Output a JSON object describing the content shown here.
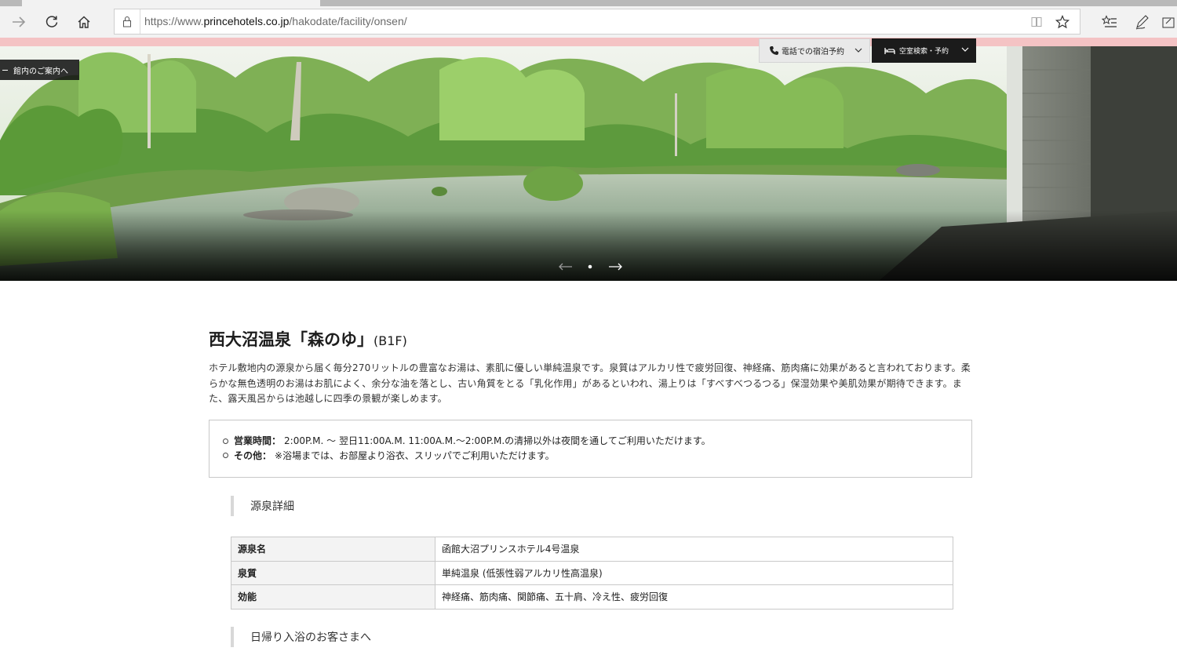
{
  "browser": {
    "url_prefix": "https://www.",
    "url_host": "princehotels.co.jp",
    "url_path": "/hakodate/facility/onsen/",
    "icons": [
      "forward-icon",
      "refresh-icon",
      "home-icon",
      "lock-icon",
      "reading-view-icon",
      "favorite-star-icon",
      "favorites-hub-icon",
      "web-note-icon",
      "share-icon"
    ]
  },
  "header": {
    "phone_booking": "電話での宿泊予約",
    "search_booking": "空室検索・予約",
    "guide_label": "館内のご案内へ"
  },
  "main": {
    "title": "西大沼温泉「森のゆ」",
    "title_sub": "(B1F)",
    "description": "ホテル敷地内の源泉から届く毎分270リットルの豊富なお湯は、素肌に優しい単純温泉です。泉質はアルカリ性で疲労回復、神経痛、筋肉痛に効果があると言われております。柔らかな無色透明のお湯はお肌によく、余分な油を落とし、古い角質をとる「乳化作用」があるといわれ、湯上りは「すべすべつるつる」保湿効果や美肌効果が期待できます。また、露天風呂からは池越しに四季の景観が楽しめます。",
    "info": [
      {
        "label": "営業時間：",
        "value": "2:00P.M. 〜 翌日11:00A.M. 11:00A.M.〜2:00P.M.の清掃以外は夜間を通してご利用いただけます。"
      },
      {
        "label": "その他：",
        "value": "※浴場までは、お部屋より浴衣、スリッパでご利用いただけます。"
      }
    ],
    "section1_title": "源泉詳細",
    "spec_rows": [
      {
        "key": "源泉名",
        "value": "函館大沼プリンスホテル4号温泉"
      },
      {
        "key": "泉質",
        "value": "単純温泉 (低張性弱アルカリ性高温泉)"
      },
      {
        "key": "効能",
        "value": "神経痛、筋肉痛、関節痛、五十肩、冷え性、疲労回復"
      }
    ],
    "section2_title": "日帰り入浴のお客さまへ"
  }
}
